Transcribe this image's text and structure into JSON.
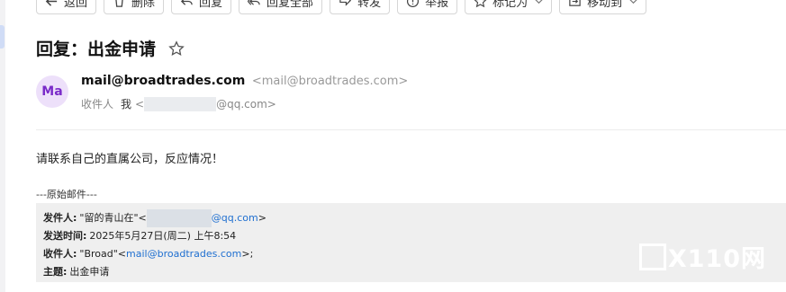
{
  "toolbar": [
    {
      "label": "返回",
      "icon": "back-arrow-icon"
    },
    {
      "label": "删除",
      "icon": "trash-icon"
    },
    {
      "label": "回复",
      "icon": "reply-icon"
    },
    {
      "label": "回复全部",
      "icon": "reply-all-icon"
    },
    {
      "label": "转发",
      "icon": "forward-icon"
    },
    {
      "label": "举报",
      "icon": "report-icon"
    },
    {
      "label": "标记为",
      "icon": "star-icon",
      "dropdown": true
    },
    {
      "label": "移动到",
      "icon": "move-icon",
      "dropdown": true
    }
  ],
  "email": {
    "subject": "回复：出金申请",
    "avatar_initials": "Ma",
    "sender_name": "mail@broadtrades.com",
    "sender_address": "<mail@broadtrades.com>",
    "recipients_label": "收件人",
    "recipient_name": "我",
    "recipient_prefix": "<",
    "recipient_domain": "@qq.com>",
    "body": "请联系自己的直属公司，反应情况！"
  },
  "original": {
    "separator": "---原始邮件---",
    "from_label": "发件人:",
    "from_name": "\"留的青山在\"<",
    "from_domain": "@qq.com",
    "from_close": ">",
    "date_label": "发送时间:",
    "date_value": "2025年5月27日(周二) 上午8:54",
    "to_label": "收件人:",
    "to_name": "\"Broad\"<",
    "to_email": "mail@broadtrades.com",
    "to_close": ">;",
    "subject_label": "主题:",
    "subject_value": "出金申请"
  },
  "watermark": "X110网",
  "colors": {
    "avatar_bg": "#ede0fa",
    "avatar_text": "#7a2bc9",
    "link": "#1f6fd0",
    "quote_bg": "#efefef"
  }
}
